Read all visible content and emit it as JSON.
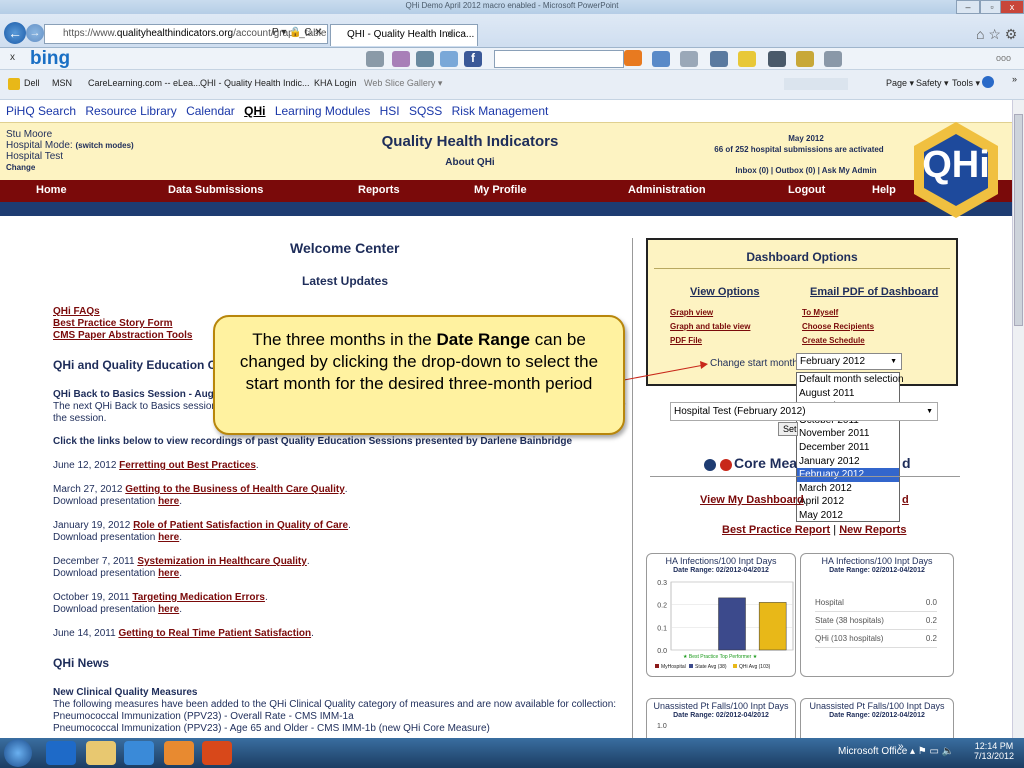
{
  "window": {
    "title": "QHi Demo April 2012 macro enabled - Microsoft PowerPoint"
  },
  "browser": {
    "url_prefix": "https://www.",
    "url_domain": "qualityhealthindicators.org",
    "url_path": "/account/graph_table",
    "url_icons": "P ▾ 🔒 C ✕",
    "tab_title": "QHI - Quality Health Indica...",
    "tab_close": "✕",
    "bing_x": "x",
    "bing_logo": "bing",
    "bing_more": "ooo",
    "favorites": [
      "Dell",
      "MSN",
      "CareLearning.com -- eLea...",
      "QHI - Quality Health Indic...",
      "KHA Login",
      "Web Slice Gallery ▾"
    ],
    "command_items": [
      "Page ▾",
      "Safety ▾",
      "Tools ▾"
    ],
    "gchevron": "»",
    "tb_right": "⌂ ☆ ⚙"
  },
  "site": {
    "top_links": [
      "PiHQ Search",
      "Resource Library",
      "Calendar",
      "QHi",
      "Learning Modules",
      "HSI",
      "SQSS",
      "Risk Management"
    ],
    "user": {
      "name": "Stu Moore",
      "mode_label": "Hospital Mode:",
      "mode_link": "(switch modes)",
      "hospital": "Hospital Test",
      "change": "Change"
    },
    "title": "Quality Health Indicators",
    "about": "About QHi",
    "right": {
      "month": "May 2012",
      "activated": "66 of 252 hospital submissions are activated",
      "links": "Inbox (0) | Outbox (0) | Ask My Admin"
    },
    "logo_text": "QHi",
    "nav": [
      "Home",
      "Data Submissions",
      "Reports",
      "My Profile",
      "Administration",
      "Logout",
      "Help"
    ]
  },
  "left": {
    "welcome": "Welcome Center",
    "latest": "Latest Updates",
    "quick_links": [
      "QHi FAQs",
      "Best Practice Story Form",
      "CMS Paper Abstraction Tools"
    ],
    "qe_heading": "QHi and Quality Education Opp",
    "session_title": "QHi Back to Basics Session - August 1",
    "session_body": "The next QHi Back to Basics session is s",
    "session_body_end": "r",
    "session_body2": "the session.",
    "recordings": "Click the links below to view recordings of past Quality Education Sessions presented by Darlene Bainbridge",
    "download_text": "Download presentation",
    "here": "here",
    "sessions": [
      {
        "date": "June 12, 2012",
        "title": "Ferretting out Best Practices",
        "download": false
      },
      {
        "date": "March 27, 2012",
        "title": "Getting to the Business of Health Care Quality",
        "download": true
      },
      {
        "date": "January 19, 2012",
        "title": "Role of Patient Satisfaction in Quality of Care",
        "download": true
      },
      {
        "date": "December 7, 2011",
        "title": "Systemization in Healthcare Quality",
        "download": true
      },
      {
        "date": "October 19, 2011",
        "title": "Targeting Medication Errors",
        "download": true
      },
      {
        "date": "June 14, 2011",
        "title": "Getting to Real Time Patient Satisfaction",
        "download": false
      }
    ],
    "news_heading": "QHi News",
    "news_title": "New Clinical Quality Measures",
    "news_body": "The following measures have been added to the QHi Clinical Quality category of measures and are now available for collection:",
    "news_items": [
      "Pneumococcal Immunization (PPV23) - Overall Rate - CMS IMM-1a",
      "Pneumococcal Immunization (PPV23) - Age 65 and Older - CMS IMM-1b (new QHi Core Measure)"
    ]
  },
  "dashboard": {
    "title": "Dashboard Options",
    "view_heading": "View Options",
    "email_heading": "Email PDF of Dashboard",
    "view_links": [
      "Graph view",
      "Graph and table view",
      "PDF File"
    ],
    "email_links": [
      "To Myself",
      "Choose Recipients",
      "Create Schedule"
    ],
    "start_label": "Change start month:",
    "start_value": "February 2012",
    "options": [
      "Default month selection",
      "August 2011",
      "September 2011",
      "October 2011",
      "November 2011",
      "December 2011",
      "January 2012",
      "February 2012",
      "March 2012",
      "April 2012",
      "May 2012"
    ],
    "selected_index": 7,
    "hospital_select": "Hospital Test (February 2012)",
    "set_btn": "Set",
    "core_label": "Core Mea",
    "core_tail": "d",
    "view_dash": "View My Dashboard",
    "view_tail": "d",
    "best_report": "Best Practice Report",
    "sep": "|",
    "new_reports": "New Reports"
  },
  "charts": {
    "infections": {
      "title": "HA Infections/100 Inpt Days",
      "range": "Date Range: 02/2012-04/2012",
      "chart_data": {
        "type": "bar",
        "categories": [
          "MyHospital",
          "State Avg (38)",
          "QHi Avg (103)"
        ],
        "values": [
          0,
          0.23,
          0.21
        ],
        "ylim": [
          0,
          0.3
        ],
        "yticks": [
          "0.0",
          "0.1",
          "0.2",
          "0.3"
        ],
        "colors": [
          "#8b1a1a",
          "#3c4a8c",
          "#e8b818"
        ],
        "annotation": "Best Practice Top Performer"
      }
    },
    "infections_table": {
      "title": "HA Infections/100 Inpt Days",
      "range": "Date Range: 02/2012-04/2012",
      "rows": [
        {
          "label": "Hospital",
          "value": "0.0"
        },
        {
          "label": "State (38 hospitals)",
          "value": "0.2"
        },
        {
          "label": "QHi (103 hospitals)",
          "value": "0.2"
        }
      ]
    },
    "falls": {
      "title": "Unassisted Pt Falls/100 Inpt Days",
      "range": "Date Range: 02/2012-04/2012",
      "ytop": "1.0"
    },
    "falls_table": {
      "title": "Unassisted Pt Falls/100 Inpt Days",
      "range": "Date Range: 02/2012-04/2012"
    }
  },
  "callout": {
    "pre": "The three months in the ",
    "bold": "Date Range",
    "post": " can be changed by clicking the drop-down to select the start month for the desired three-month period"
  },
  "taskbar": {
    "office": "Microsoft Office",
    "office_chev": "»",
    "tray": "▴ ⚑ ▭ 🔈",
    "time": "12:14 PM",
    "date": "7/13/2012"
  },
  "colors": {
    "nav_bg": "#7a0a0a",
    "header_bg": "#fdf3c2",
    "link": "#7a0a0a",
    "navy": "#1e3c72"
  }
}
